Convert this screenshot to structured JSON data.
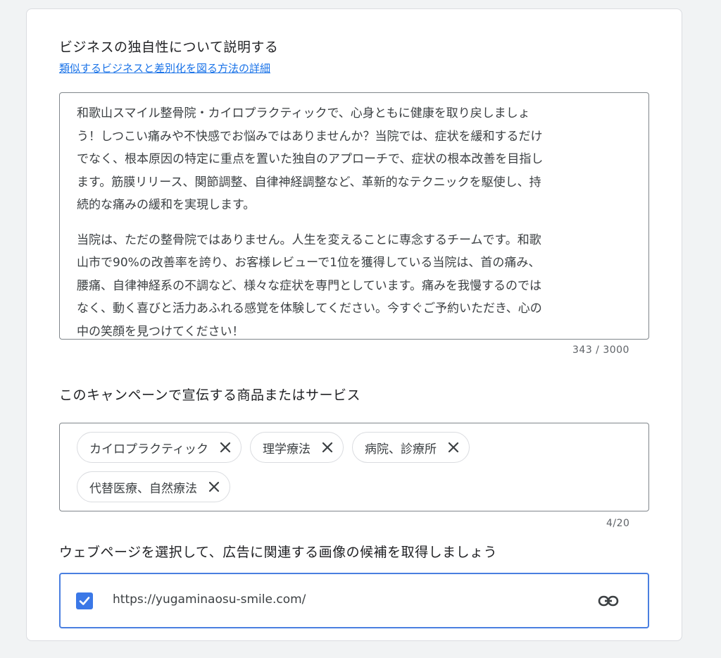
{
  "description_section": {
    "title": "ビジネスの独自性について説明する",
    "help_link": "類似するビジネスと差別化を図る方法の詳細",
    "paragraph_1_lines": [
      "和歌山スマイル整骨院・カイロプラクティックで、心身ともに健康を取り戻しましょ",
      "う！しつこい痛みや不快感でお悩みではありませんか？当院では、症状を緩和するだけ",
      "でなく、根本原因の特定に重点を置いた独自のアプローチで、症状の根本改善を目指し",
      "ます。筋膜リリース、関節調整、自律神経調整など、革新的なテクニックを駆使し、持",
      "続的な痛みの緩和を実現します。"
    ],
    "paragraph_2_lines": [
      "当院は、ただの整骨院ではありません。人生を変えることに専念するチームです。和歌",
      "山市で90%の改善率を誇り、お客様レビューで1位を獲得している当院は、首の痛み、",
      "腰痛、自律神経系の不調など、様々な症状を専門としています。痛みを我慢するのでは",
      "なく、動く喜びと活力あふれる感覚を体験してください。今すぐご予約いただき、心の",
      "中の笑顔を見つけてください！"
    ],
    "char_counter": "343 / 3000"
  },
  "products_section": {
    "title": "このキャンペーンで宣伝する商品またはサービス",
    "chips": [
      "カイロプラクティック",
      "理学療法",
      "病院、診療所",
      "代替医療、自然療法"
    ],
    "chip_counter": "4/20"
  },
  "webpage_section": {
    "title": "ウェブページを選択して、広告に関連する画像の候補を取得しましょう",
    "url": "https://yugaminaosu-smile.com/",
    "checked": true,
    "checkbox_icon": "check-icon",
    "link_icon": "link-icon"
  },
  "colors": {
    "accent": "#1a73e8",
    "checkbox": "#3b78e7",
    "focus_border": "#4a7fe0"
  }
}
